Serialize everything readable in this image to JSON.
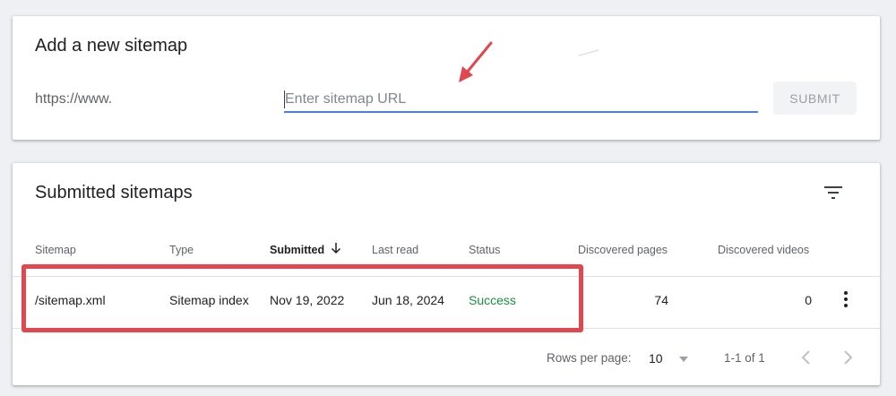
{
  "add_card": {
    "title": "Add a new sitemap",
    "url_prefix": "https://www.",
    "input_placeholder": "Enter sitemap URL",
    "input_value": "",
    "submit_label": "SUBMIT"
  },
  "list_card": {
    "title": "Submitted sitemaps",
    "columns": {
      "sitemap": "Sitemap",
      "type": "Type",
      "submitted": "Submitted",
      "last_read": "Last read",
      "status": "Status",
      "discovered_pages": "Discovered pages",
      "discovered_videos": "Discovered videos"
    },
    "sort_column": "submitted",
    "sort_direction": "descending",
    "rows": [
      {
        "sitemap": "/sitemap.xml",
        "type": "Sitemap index",
        "submitted": "Nov 19, 2022",
        "last_read": "Jun 18, 2024",
        "status": "Success",
        "discovered_pages": "74",
        "discovered_videos": "0"
      }
    ],
    "footer": {
      "rows_per_page_label": "Rows per page:",
      "rows_per_page_value": "10",
      "range": "1-1 of 1"
    }
  },
  "colors": {
    "accent_underline": "#4a7ee8",
    "success": "#1e8e3e",
    "annotation_red": "#e0474f",
    "background": "#eef0f3"
  },
  "icons": [
    "filter-icon",
    "sort-down-arrow-icon",
    "more-vert-icon",
    "dropdown-caret-icon",
    "chevron-left-icon",
    "chevron-right-icon"
  ]
}
